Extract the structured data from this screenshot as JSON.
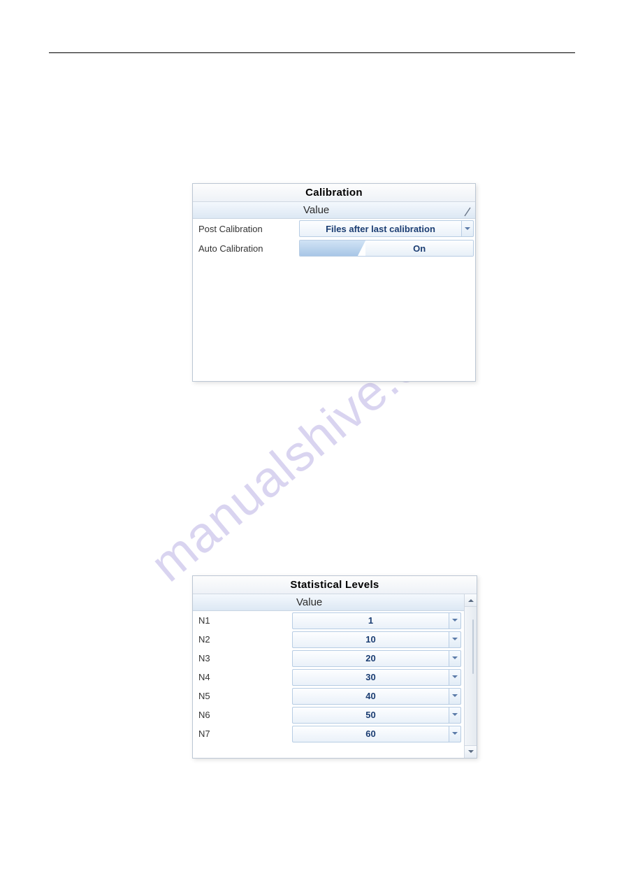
{
  "watermark": "manualshive.com",
  "panel1": {
    "title": "Calibration",
    "header": {
      "col2": "Value"
    },
    "rows": [
      {
        "label": "Post Calibration",
        "type": "dropdown",
        "value": "Files after last calibration"
      },
      {
        "label": "Auto Calibration",
        "type": "toggle",
        "value": "On"
      }
    ]
  },
  "panel2": {
    "title": "Statistical Levels",
    "header": {
      "col2": "Value"
    },
    "rows": [
      {
        "label": "N1",
        "value": "1"
      },
      {
        "label": "N2",
        "value": "10"
      },
      {
        "label": "N3",
        "value": "20"
      },
      {
        "label": "N4",
        "value": "30"
      },
      {
        "label": "N5",
        "value": "40"
      },
      {
        "label": "N6",
        "value": "50"
      },
      {
        "label": "N7",
        "value": "60"
      }
    ]
  }
}
